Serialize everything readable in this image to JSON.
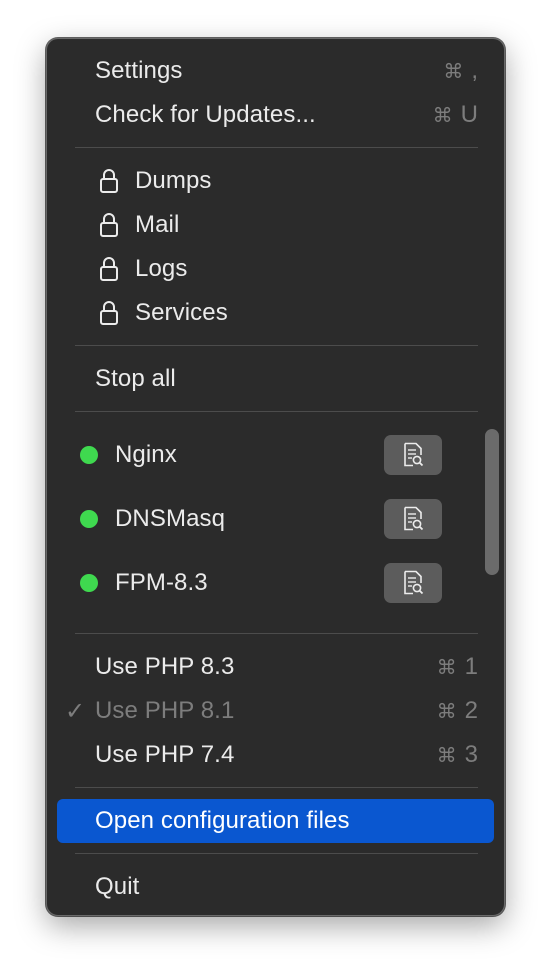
{
  "menu": {
    "settings": {
      "label": "Settings",
      "shortcut_key": ","
    },
    "check_updates": {
      "label": "Check for Updates...",
      "shortcut_key": "U"
    },
    "locked_items": [
      {
        "label": "Dumps"
      },
      {
        "label": "Mail"
      },
      {
        "label": "Logs"
      },
      {
        "label": "Services"
      }
    ],
    "stop_all": {
      "label": "Stop all"
    },
    "services": [
      {
        "name": "Nginx",
        "status_color": "#3fd94f"
      },
      {
        "name": "DNSMasq",
        "status_color": "#3fd94f"
      },
      {
        "name": "FPM-8.3",
        "status_color": "#3fd94f"
      }
    ],
    "php_versions": [
      {
        "label": "Use PHP 8.3",
        "shortcut_key": "1",
        "checked": false
      },
      {
        "label": "Use PHP 8.1",
        "shortcut_key": "2",
        "checked": true
      },
      {
        "label": "Use PHP 7.4",
        "shortcut_key": "3",
        "checked": false
      }
    ],
    "open_config": {
      "label": "Open configuration files"
    },
    "quit": {
      "label": "Quit"
    },
    "cmd_symbol": "⌘",
    "check_symbol": "✓"
  },
  "colors": {
    "menu_background": "#2b2b2b",
    "highlight": "#0a57d0",
    "status_running": "#3fd94f"
  }
}
